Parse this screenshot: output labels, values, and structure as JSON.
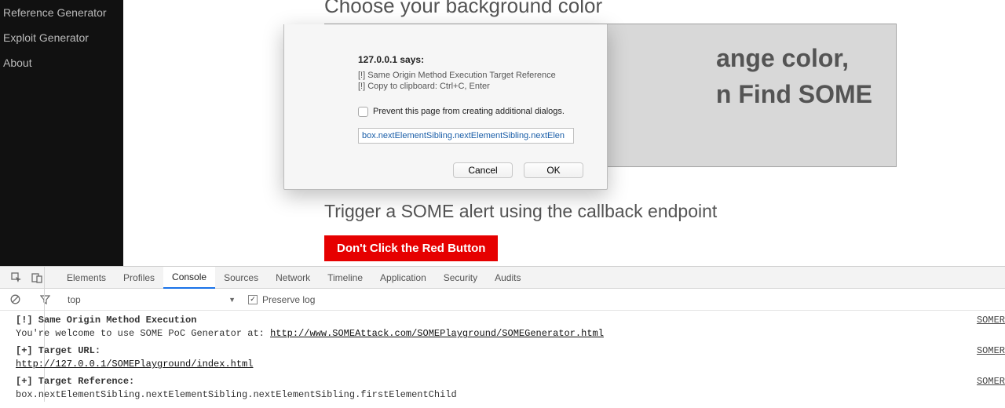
{
  "sidebar": {
    "items": [
      {
        "label": "Reference Generator"
      },
      {
        "label": "Exploit Generator"
      },
      {
        "label": "About"
      }
    ]
  },
  "main": {
    "heading_cut": "Choose your background color",
    "box_line1": "ange color,",
    "box_line2": "n Find SOME",
    "trigger_text": "Trigger a SOME alert using the callback endpoint",
    "red_button": "Don't Click the Red Button"
  },
  "dialog": {
    "host_says": "127.0.0.1 says:",
    "line1": "[!] Same Origin Method Execution Target Reference",
    "line2": "[!] Copy to clipboard: Ctrl+C, Enter",
    "prevent_label": "Prevent this page from creating additional dialogs.",
    "input_value": "box.nextElementSibling.nextElementSibling.nextElen",
    "cancel": "Cancel",
    "ok": "OK"
  },
  "devtools": {
    "tabs": [
      "Elements",
      "Profiles",
      "Console",
      "Sources",
      "Network",
      "Timeline",
      "Application",
      "Security",
      "Audits"
    ],
    "active_tab": "Console",
    "context": "top",
    "preserve_log": "Preserve log",
    "src_link": "SOMER",
    "log": {
      "l1_bold": "[!] Same Origin Method Execution",
      "l1_text": "You're welcome to use SOME PoC Generator at: ",
      "l1_link": "http://www.SOMEAttack.com/SOMEPlayground/SOMEGenerator.html",
      "l2_bold": "[+] Target URL:",
      "l2_link": "http://127.0.0.1/SOMEPlayground/index.html",
      "l3_bold": "[+] Target Reference:",
      "l3_text": "box.nextElementSibling.nextElementSibling.nextElementSibling.firstElementChild"
    }
  }
}
